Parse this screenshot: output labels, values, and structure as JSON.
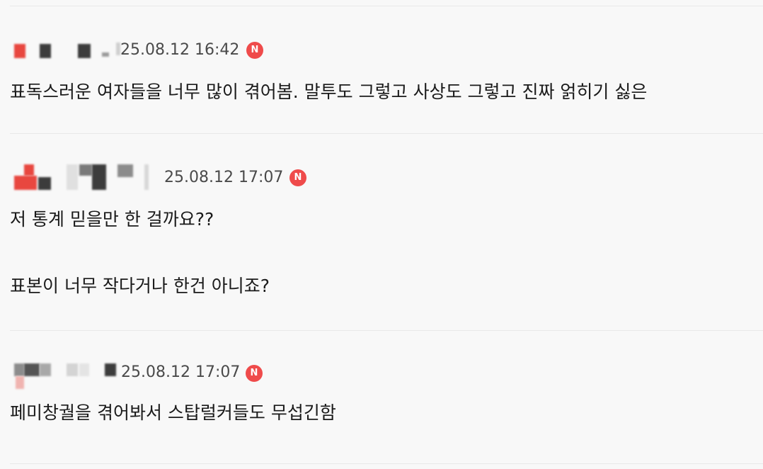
{
  "comments": [
    {
      "timestamp": "25.08.12 16:42",
      "badge": "N",
      "lines": [
        "표독스러운 여자들을 너무 많이 겪어봄. 말투도 그렇고 사상도 그렇고 진짜 얽히기 싫은"
      ]
    },
    {
      "timestamp": "25.08.12 17:07",
      "badge": "N",
      "lines": [
        "저 통계 믿을만 한 걸까요??",
        "표본이 너무 작다거나 한건 아니죠?"
      ]
    },
    {
      "timestamp": "25.08.12 17:07",
      "badge": "N",
      "lines": [
        "페미창궐을 겪어봐서 스탑럴커들도 무섭긴함"
      ]
    }
  ],
  "colors": {
    "badge": "#ef4b4b",
    "background": "#f8f8f8",
    "divider": "#e9e9e9"
  }
}
